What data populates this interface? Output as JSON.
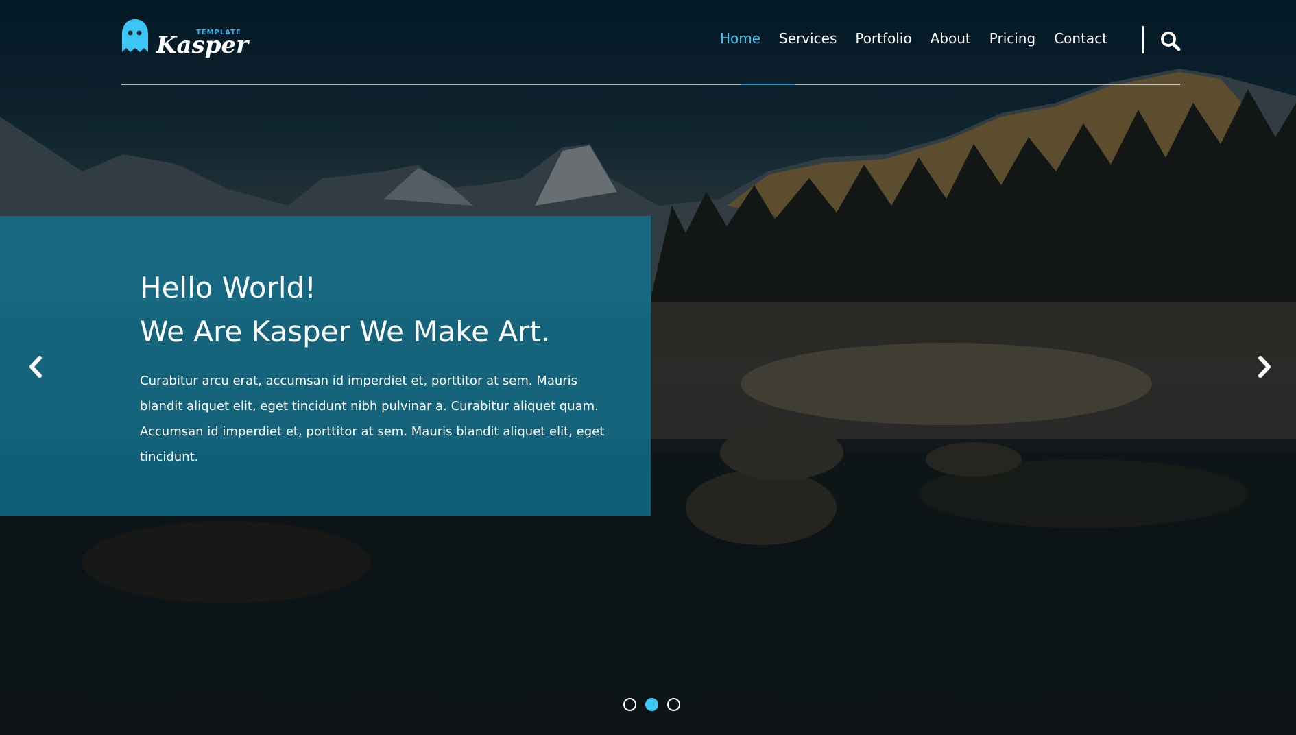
{
  "brand": {
    "name": "Kasper",
    "tagline": "TEMPLATE",
    "accent_color": "#3cc6f3",
    "logo_icon": "ghost-icon"
  },
  "nav": {
    "items": [
      {
        "label": "Home",
        "active": true
      },
      {
        "label": "Services",
        "active": false
      },
      {
        "label": "Portfolio",
        "active": false
      },
      {
        "label": "About",
        "active": false
      },
      {
        "label": "Pricing",
        "active": false
      },
      {
        "label": "Contact",
        "active": false
      }
    ],
    "search_icon": "search-icon"
  },
  "hero": {
    "title_line1": "Hello World!",
    "title_line2": "We Are Kasper We Make Art.",
    "description": "Curabitur arcu erat, accumsan id imperdiet et, porttitor at sem. Mauris blandit aliquet elit, eget tincidunt nibh pulvinar a. Curabitur aliquet quam. Accumsan id imperdiet et, porttitor at sem. Mauris blandit aliquet elit, eget tincidunt.",
    "panel_color": "#0f7594",
    "prev_icon": "chevron-left-icon",
    "next_icon": "chevron-right-icon"
  },
  "slider": {
    "slide_count": 3,
    "active_index": 1
  }
}
